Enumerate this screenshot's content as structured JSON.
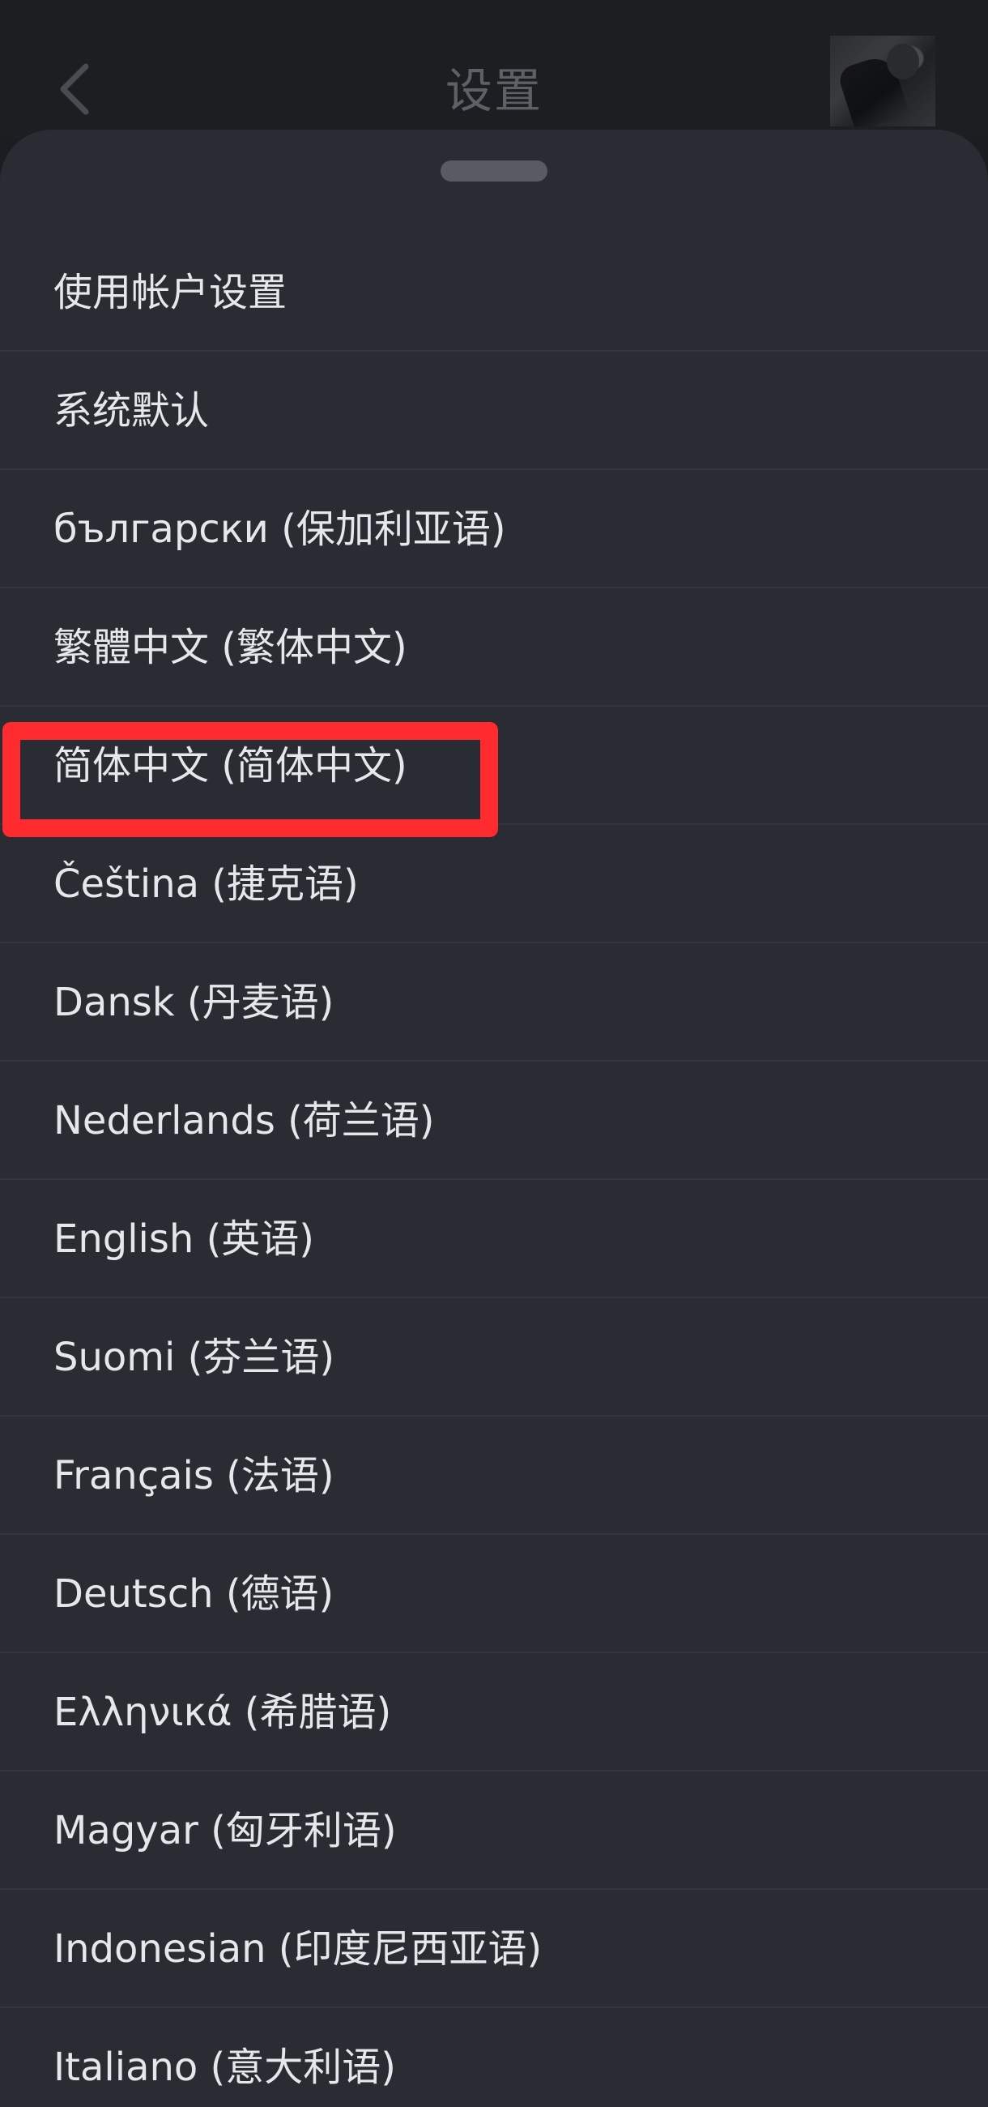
{
  "header": {
    "title": "设置",
    "back_icon": "chevron-left-icon"
  },
  "language_options": [
    {
      "label": "使用帐户设置"
    },
    {
      "label": "系统默认"
    },
    {
      "label": "български (保加利亚语)"
    },
    {
      "label": "繁體中文 (繁体中文)"
    },
    {
      "label": "简体中文 (简体中文)",
      "highlighted": true
    },
    {
      "label": "Čeština (捷克语)"
    },
    {
      "label": "Dansk (丹麦语)"
    },
    {
      "label": "Nederlands (荷兰语)"
    },
    {
      "label": "English (英语)"
    },
    {
      "label": "Suomi (芬兰语)"
    },
    {
      "label": "Français (法语)"
    },
    {
      "label": "Deutsch (德语)"
    },
    {
      "label": "Ελληνικά (希腊语)"
    },
    {
      "label": "Magyar (匈牙利语)"
    },
    {
      "label": "Indonesian (印度尼西亚语)"
    },
    {
      "label": "Italiano (意大利语)"
    }
  ],
  "colors": {
    "background": "#1c1d21",
    "sheet": "#2a2c33",
    "divider": "#34363e",
    "text": "#e6e7ea",
    "highlight": "#ff2b2e"
  }
}
